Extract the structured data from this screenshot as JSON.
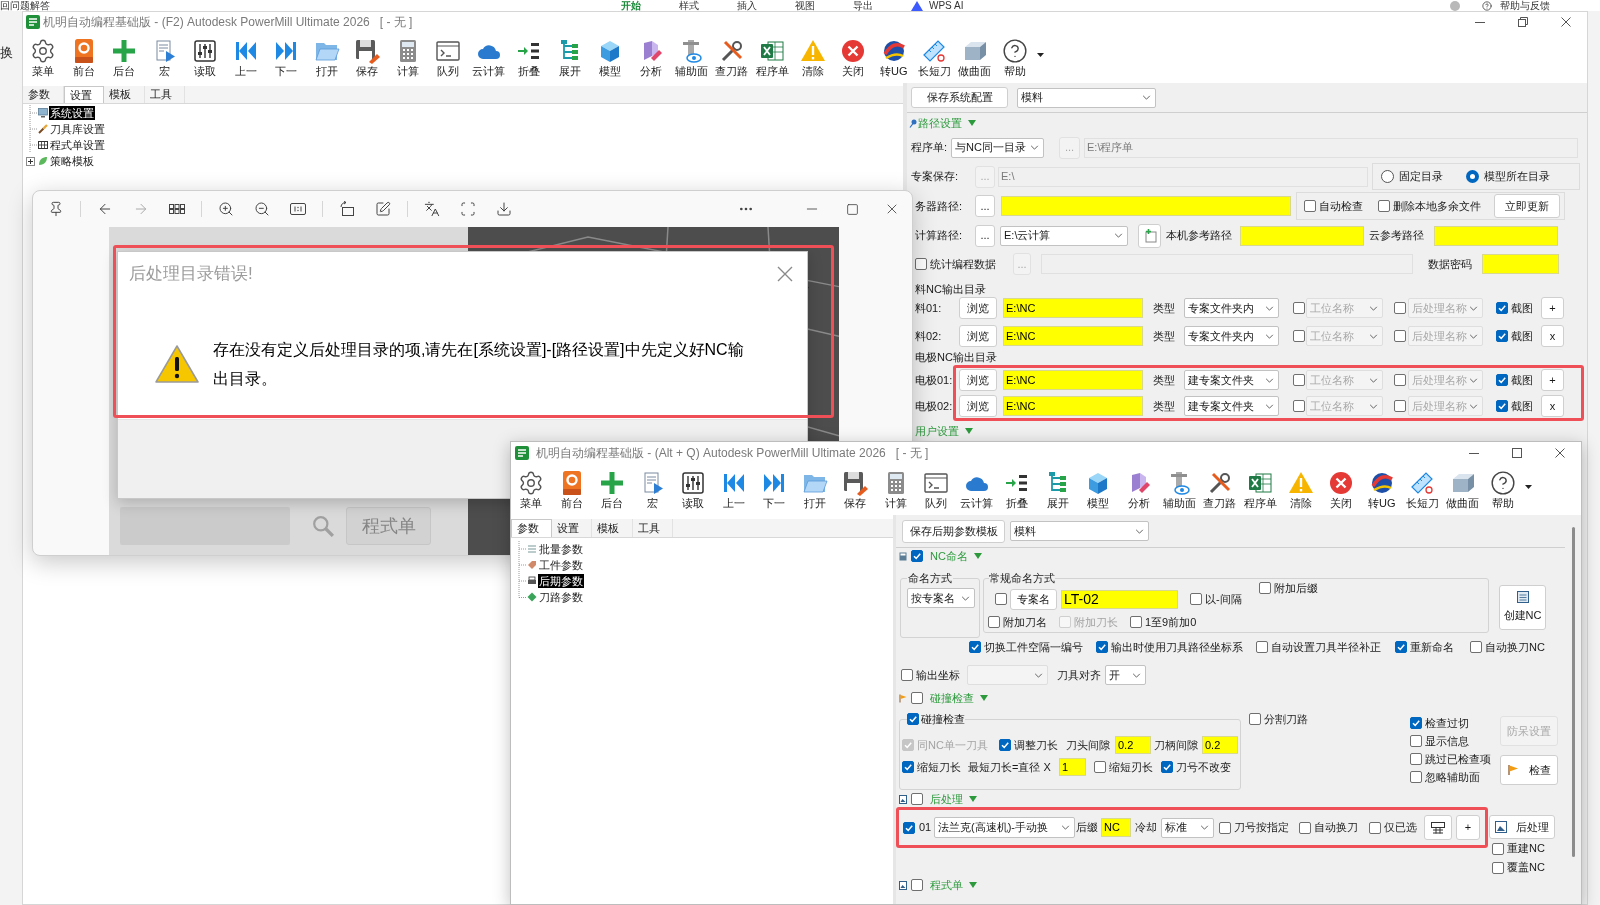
{
  "desktop": {
    "doc_title": "回问题解答",
    "ribbon_tabs": [
      {
        "label": "开始",
        "selected": true
      },
      {
        "label": "样式",
        "selected": false
      },
      {
        "label": "插入",
        "selected": false
      },
      {
        "label": "视图",
        "selected": false
      },
      {
        "label": "导出",
        "selected": false
      }
    ],
    "ai_label": "WPS AI",
    "help_label": "帮助与反馈",
    "side_text": "换"
  },
  "main_window": {
    "title": "机明自动编程基础版 - (F2) Autodesk PowerMill Ultimate 2026   [ - 无 ]",
    "maximized": true,
    "toolbar": [
      "菜单",
      "前台",
      "后台",
      "宏",
      "读取",
      "上一",
      "下一",
      "打开",
      "保存",
      "计算",
      "队列",
      "云计算",
      "折叠",
      "展开",
      "模型",
      "分析",
      "辅助面",
      "查刀路",
      "程序单",
      "清除",
      "关闭",
      "转UG",
      "长短刀",
      "做曲面",
      "帮助"
    ],
    "tabs": [
      {
        "label": "参数",
        "selected": false
      },
      {
        "label": "设置",
        "selected": true
      },
      {
        "label": "模板",
        "selected": false
      },
      {
        "label": "工具",
        "selected": false
      }
    ],
    "tree": [
      {
        "label": "系统设置",
        "kind": "leaf",
        "selected": true
      },
      {
        "label": "刀具库设置",
        "kind": "leaf",
        "selected": false
      },
      {
        "label": "程式单设置",
        "kind": "leaf",
        "selected": false
      },
      {
        "label": "策略模板",
        "kind": "group",
        "expanded": false,
        "selected": false
      }
    ],
    "panel": {
      "save_button": "保存系统配置",
      "profile": "模料",
      "section": {
        "label": "路径设置",
        "expanded": true
      },
      "program_sheet": {
        "label": "程序单:",
        "option": "与NC同一目录",
        "browse": {
          "label": "...",
          "disabled": true
        },
        "path": "E:\\程序单"
      },
      "project_save": {
        "label": "专案保存:",
        "browse": {
          "label": "...",
          "disabled": true
        },
        "path": "E:\\",
        "radios": [
          {
            "label": "固定目录",
            "selected": false
          },
          {
            "label": "模型所在目录",
            "selected": true
          }
        ]
      },
      "server_path": {
        "label": "务器路径:",
        "browse": {
          "label": "...",
          "disabled": false
        },
        "checks": [
          {
            "label": "自动检查",
            "checked": false
          },
          {
            "label": "删除本地多余文件",
            "checked": false
          }
        ],
        "update_button": "立即更新"
      },
      "cloud_path": {
        "label": "计算路径:",
        "browse": {
          "label": "...",
          "disabled": false
        },
        "option": "E:\\云计算",
        "local_ref_label": "本机参考路径",
        "cloud_ref_label": "云参考路径"
      },
      "statistics": {
        "label": "统计编程数据",
        "checked": false,
        "browse": {
          "label": "...",
          "disabled": true
        },
        "password_label": "数据密码"
      },
      "outputs": [
        {
          "title": "料NC输出目录",
          "highlighted": false,
          "rows": [
            {
              "label": "料01:",
              "browse": "浏览",
              "path": "E:\\NC",
              "type_label": "类型",
              "type": "专案文件夹内",
              "station": {
                "checked": false,
                "value": "工位名称"
              },
              "post": {
                "checked": false,
                "value": "后处理名称"
              },
              "snapshot": {
                "label": "截图",
                "checked": true
              },
              "action": "+"
            },
            {
              "label": "料02:",
              "browse": "浏览",
              "path": "E:\\NC",
              "type_label": "类型",
              "type": "专案文件夹内",
              "station": {
                "checked": false,
                "value": "工位名称"
              },
              "post": {
                "checked": false,
                "value": "后处理名称"
              },
              "snapshot": {
                "label": "截图",
                "checked": true
              },
              "action": "x"
            }
          ]
        },
        {
          "title": "电极NC输出目录",
          "highlighted": true,
          "rows": [
            {
              "label": "电极01:",
              "browse": "浏览",
              "path": "E:\\NC",
              "type_label": "类型",
              "type": "建专案文件夹",
              "station": {
                "checked": false,
                "value": "工位名称"
              },
              "post": {
                "checked": false,
                "value": "后处理名称"
              },
              "snapshot": {
                "label": "截图",
                "checked": true
              },
              "action": "+"
            },
            {
              "label": "电极02:",
              "browse": "浏览",
              "path": "E:\\NC",
              "type_label": "类型",
              "type": "建专案文件夹",
              "station": {
                "checked": false,
                "value": "工位名称"
              },
              "post": {
                "checked": false,
                "value": "后处理名称"
              },
              "snapshot": {
                "label": "截图",
                "checked": true
              },
              "action": "x"
            }
          ]
        }
      ],
      "next_section": {
        "label": "用户设置",
        "expanded": true
      }
    }
  },
  "image_viewer": {
    "image": {
      "dialog": {
        "title": "后处理目录错误!",
        "message": "存在没有定义后处理目录的项,请先在[系统设置]-[路径设置]中先定义好NC输出目录。",
        "highlighted": true
      },
      "faded_label": "程式单"
    }
  },
  "second_window": {
    "title": "机明自动编程基础版 - (Alt + Q) Autodesk PowerMill Ultimate 2026   [ - 无 ]",
    "maximized": false,
    "toolbar": [
      "菜单",
      "前台",
      "后台",
      "宏",
      "读取",
      "上一",
      "下一",
      "打开",
      "保存",
      "计算",
      "队列",
      "云计算",
      "折叠",
      "展开",
      "模型",
      "分析",
      "辅助面",
      "查刀路",
      "程序单",
      "清除",
      "关闭",
      "转UG",
      "长短刀",
      "做曲面",
      "帮助"
    ],
    "tabs": [
      {
        "label": "参数",
        "selected": true
      },
      {
        "label": "设置",
        "selected": false
      },
      {
        "label": "模板",
        "selected": false
      },
      {
        "label": "工具",
        "selected": false
      }
    ],
    "tree": [
      {
        "label": "批量参数",
        "kind": "leaf",
        "selected": false
      },
      {
        "label": "工件参数",
        "kind": "leaf",
        "selected": false
      },
      {
        "label": "后期参数",
        "kind": "leaf",
        "selected": true
      },
      {
        "label": "刀路参数",
        "kind": "leaf",
        "selected": false
      }
    ],
    "panel": {
      "save_button": "保存后期参数模板",
      "profile": "模料",
      "nc_naming": {
        "label": "NC命名",
        "checked": true,
        "expanded": true,
        "method_title": "命名方式",
        "method": "按专案名",
        "regular_title": "常规命名方式",
        "project_name": {
          "checked": false,
          "button": "专案名",
          "value": "LT-02"
        },
        "dash_separator": {
          "label": "以-间隔",
          "checked": false
        },
        "suffix": {
          "label": "附加后缀",
          "checked": false
        },
        "options": [
          {
            "label": "附加刀名",
            "checked": false,
            "disabled": false
          },
          {
            "label": "附加刀长",
            "checked": false,
            "disabled": true
          },
          {
            "label": "1至9前加0",
            "checked": false,
            "disabled": false
          }
        ],
        "create_button": "创建NC",
        "flags": [
          {
            "label": "切换工件空隔一编号",
            "checked": true
          },
          {
            "label": "输出时使用刀具路径坐标系",
            "checked": true
          },
          {
            "label": "自动设置刀具半径补正",
            "checked": false
          },
          {
            "label": "重新命名",
            "checked": true
          },
          {
            "label": "自动换刀NC",
            "checked": false
          }
        ],
        "output_coords": {
          "label": "输出坐标",
          "checked": false
        },
        "tool_align": {
          "label": "刀具对齐",
          "value": "开"
        }
      },
      "collision": {
        "label": "碰撞检查",
        "checked": false,
        "expanded": true,
        "group": {
          "label": "碰撞检查",
          "checked": true
        },
        "rows": [
          [
            {
              "kind": "check",
              "label": "同NC单一刀具",
              "checked": true,
              "disabled": true
            },
            {
              "kind": "check",
              "label": "调整刀长",
              "checked": true,
              "disabled": false
            },
            {
              "kind": "field",
              "label": "刀头间隙",
              "value": "0.2"
            },
            {
              "kind": "field",
              "label": "刀柄间隙",
              "value": "0.2"
            }
          ],
          [
            {
              "kind": "check",
              "label": "缩短刀长",
              "checked": true,
              "disabled": false
            },
            {
              "kind": "field",
              "label": "最短刀长=直径 X",
              "value": "1"
            },
            {
              "kind": "check",
              "label": "缩短刃长",
              "checked": false,
              "disabled": false
            },
            {
              "kind": "check",
              "label": "刀号不改变",
              "checked": true,
              "disabled": false
            }
          ]
        ],
        "split_paths": {
          "label": "分割刀路",
          "checked": false
        },
        "checks": [
          {
            "label": "检查过切",
            "checked": true
          },
          {
            "label": "显示信息",
            "checked": false
          },
          {
            "label": "跳过已检查项",
            "checked": false
          },
          {
            "label": "忽略辅助面",
            "checked": false
          }
        ],
        "guard_button": {
          "label": "防呆设置",
          "disabled": true
        },
        "check_button": "检查"
      },
      "post": {
        "label": "后处理",
        "checked": false,
        "expanded": true,
        "row": {
          "highlighted": true,
          "checked": true,
          "index": "01",
          "machine": "法兰克(高速机)-手动换",
          "suffix_label": "后缀",
          "suffix": "NC",
          "coolant_label": "冷却",
          "coolant": "标准",
          "options": [
            {
              "label": "刀号按指定",
              "checked": false
            },
            {
              "label": "自动换刀",
              "checked": false
            },
            {
              "label": "仅已选",
              "checked": false
            }
          ],
          "add_button": "+"
        },
        "post_button": "后处理",
        "rebuild": {
          "label": "重建NC",
          "checked": false
        },
        "overwrite": {
          "label": "覆盖NC",
          "checked": false
        }
      },
      "program_sheet": {
        "label": "程式单",
        "checked": false,
        "expanded": true
      }
    }
  }
}
